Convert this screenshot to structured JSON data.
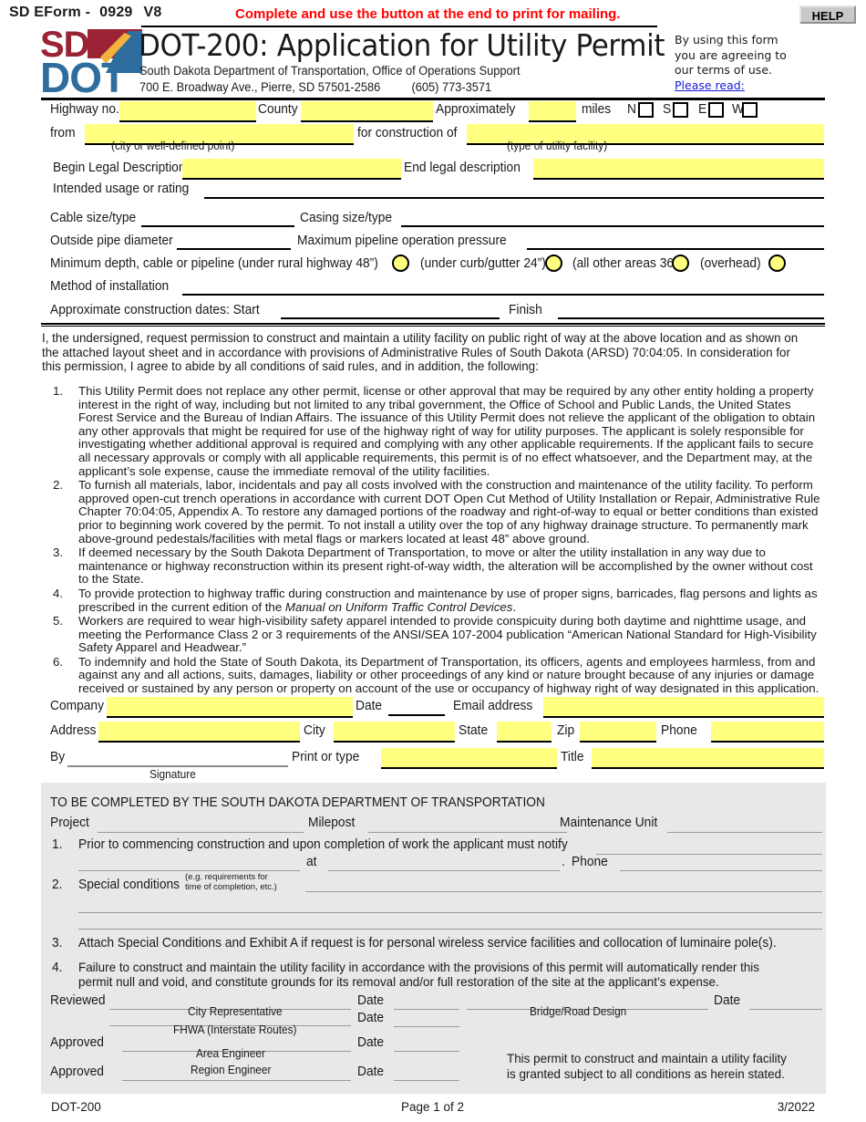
{
  "header": {
    "eform_label": "SD EForm -",
    "eform_number": "0929",
    "version": "V8",
    "notice": "Complete and use the button at the end to print for mailing.",
    "help_button": "HELP",
    "title": "DOT-200: Application for Utility Permit",
    "agency_line": "South Dakota Department of Transportation, Office of Operations Support",
    "address_line": "700 E. Broadway Ave., Pierre, SD 57501-2586",
    "phone": "(605) 773-3571",
    "terms_line1": "By using this form",
    "terms_line2": "you are agreeing to",
    "terms_line3": "our terms of use.",
    "terms_link": "Please read:"
  },
  "fields": {
    "highway_no": "Highway no.",
    "county": "County",
    "approximately": "Approximately",
    "miles": "miles",
    "dir_n": "N",
    "dir_s": "S",
    "dir_e": "E",
    "dir_w": "W",
    "from": "from",
    "from_caption": "(city or well-defined point)",
    "for_construction_of": "for construction of",
    "construction_caption": "(type of utility facility)",
    "begin_legal": "Begin Legal Description",
    "end_legal": "End legal description",
    "intended_usage": "Intended usage or rating",
    "cable_size": "Cable size/type",
    "casing_size": "Casing size/type",
    "outside_pipe": "Outside pipe diameter",
    "max_pressure": "Maximum pipeline operation pressure",
    "min_depth": "Minimum depth, cable or pipeline (under rural highway 48”)",
    "opt_curb": "(under curb/gutter 24”)",
    "opt_other": "(all other areas 36”)",
    "opt_overhead": "(overhead)",
    "method_install": "Method of installation",
    "approx_dates": "Approximate construction dates:  Start",
    "finish": "Finish"
  },
  "intro": "I, the undersigned, request permission to construct and maintain a utility facility on public right of way at the above location and as shown on the attached layout sheet and in accordance with provisions of Administrative Rules of South Dakota (ARSD) 70:04:05. In consideration for this permission, I agree to abide by all conditions of said rules, and in addition, the following:",
  "conditions": [
    {
      "n": "1.",
      "text": "This Utility Permit does not replace any other permit, license or other approval that may be required by any other entity holding a property interest in the right of way, including but not limited to any tribal government, the Office of School and Public Lands, the United States Forest Service and the Bureau of Indian Affairs. The issuance of this Utility Permit does not relieve the applicant of the obligation to obtain any other approvals that might be required for use of the highway right of way for utility purposes. The applicant is solely responsible for investigating whether additional approval is required and complying with any other applicable requirements. If the applicant fails to secure all necessary approvals or comply with all applicable requirements, this permit is of no effect whatsoever, and the Department may, at the applicant’s sole expense, cause the immediate removal of the utility facilities."
    },
    {
      "n": "2.",
      "text": "To furnish all materials, labor, incidentals and pay all costs involved with the construction and maintenance of the utility facility. To perform approved open-cut trench operations in accordance with current DOT Open Cut Method of Utility Installation or Repair, Administrative Rule Chapter 70:04:05, Appendix A. To restore any damaged portions of the roadway and right-of-way to equal or better conditions than existed prior to beginning work covered by the permit. To not install a utility over the top of any highway drainage structure. To permanently mark above-ground pedestals/facilities with metal flags or markers located at least 48” above ground."
    },
    {
      "n": "3.",
      "text": "If deemed necessary by the South Dakota Department of Transportation, to move or alter the utility installation in any way due to maintenance or highway reconstruction within its present right-of-way width, the alteration will be accomplished by the owner without cost to the State."
    },
    {
      "n": "4.",
      "text_pre": "To provide protection to highway traffic during construction and maintenance by use of proper signs, barricades, flag persons and lights as prescribed in the current edition of the ",
      "text_italic": "Manual on Uniform Traffic Control Devices",
      "text_post": "."
    },
    {
      "n": "5.",
      "text": "Workers are required to wear high-visibility safety apparel intended to provide conspicuity during both daytime and nighttime usage, and meeting the Performance Class 2 or 3 requirements of the ANSI/SEA 107-2004 publication “American National Standard for High-Visibility Safety Apparel and Headwear.”"
    },
    {
      "n": "6.",
      "text": "To indemnify and hold the State of South Dakota, its Department of Transportation, its officers, agents and employees harmless, from and against any and all actions, suits, damages, liability or other proceedings of any kind or nature brought because of any injuries or damage received or sustained by any person or property on account of the use or occupancy of highway right of way designated in this application."
    }
  ],
  "applicant": {
    "company": "Company",
    "date": "Date",
    "email": "Email address",
    "address": "Address",
    "city": "City",
    "state": "State",
    "zip": "Zip",
    "phone": "Phone",
    "by": "By",
    "signature_caption": "Signature",
    "print_or_type": "Print or type",
    "title": "Title"
  },
  "dot_section": {
    "heading": "TO BE COMPLETED BY THE SOUTH DAKOTA DEPARTMENT OF TRANSPORTATION",
    "project": "Project",
    "milepost": "Milepost",
    "maintenance_unit": "Maintenance Unit",
    "item1_n": "1.",
    "item1_text": "Prior to commencing construction and upon completion of work the applicant must notify",
    "item1_at": "at",
    "item1_period": ".",
    "item1_phone": "Phone",
    "item2_n": "2.",
    "item2_label": "Special conditions",
    "item2_note1": "(e.g. requirements for",
    "item2_note2": "time of completion, etc.)",
    "item3_n": "3.",
    "item3_text": "Attach Special Conditions and Exhibit A if request is for personal wireless service facilities and collocation of luminaire pole(s).",
    "item4_n": "4.",
    "item4_text": "Failure to construct and maintain the utility facility in accordance with the provisions of this permit will automatically render this permit null and void, and constitute grounds for its removal and/or full restoration of the site at the applicant’s expense.",
    "reviewed": "Reviewed",
    "approved": "Approved",
    "date": "Date",
    "cap_city_rep": "City Representative",
    "cap_fhwa": "FHWA (Interstate Routes)",
    "cap_area_eng": "Area Engineer",
    "cap_region_eng": "Region Engineer",
    "cap_bridge_road": "Bridge/Road Design",
    "grant_line1": "This permit to construct and maintain a utility facility",
    "grant_line2": "is granted subject to all conditions as herein stated."
  },
  "footer": {
    "left": "DOT-200",
    "center": "Page 1 of 2",
    "right": "3/2022"
  },
  "colors": {
    "field_yellow": "#ffff80",
    "notice_red": "#ff0000",
    "link_blue": "#1919d6",
    "panel_gray": "#e8e8e8",
    "logo_red": "#9b2335",
    "logo_blue": "#2e6d9e"
  }
}
